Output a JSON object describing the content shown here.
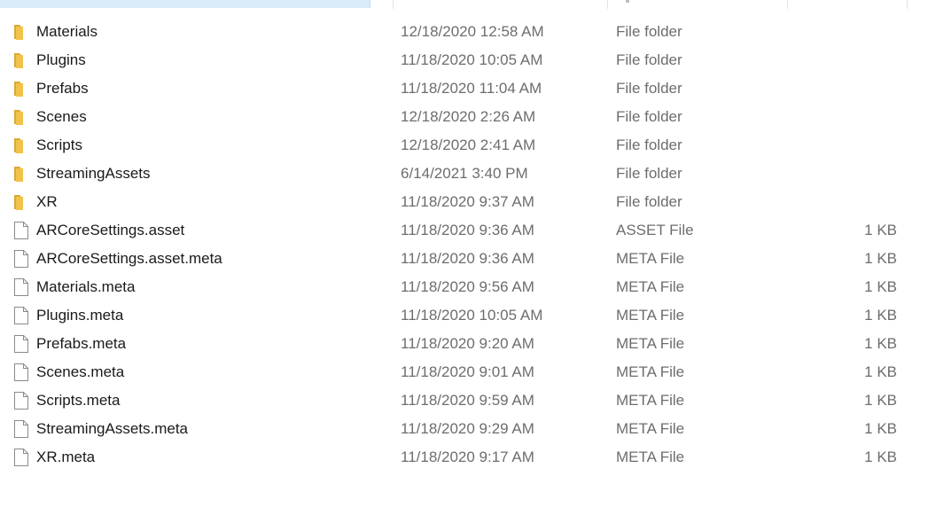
{
  "colors": {
    "folder": "#f2c34a",
    "folder_dark": "#dba933",
    "file_outline": "#8a8a8a",
    "header_selected": "#d9ebf9",
    "secondary_text": "#6d6d6d"
  },
  "files": [
    {
      "name": "Materials",
      "date": "12/18/2020 12:58 AM",
      "type": "File folder",
      "size": "",
      "icon": "folder-icon"
    },
    {
      "name": "Plugins",
      "date": "11/18/2020 10:05 AM",
      "type": "File folder",
      "size": "",
      "icon": "folder-icon"
    },
    {
      "name": "Prefabs",
      "date": "11/18/2020 11:04 AM",
      "type": "File folder",
      "size": "",
      "icon": "folder-icon"
    },
    {
      "name": "Scenes",
      "date": "12/18/2020 2:26 AM",
      "type": "File folder",
      "size": "",
      "icon": "folder-icon"
    },
    {
      "name": "Scripts",
      "date": "12/18/2020 2:41 AM",
      "type": "File folder",
      "size": "",
      "icon": "folder-icon"
    },
    {
      "name": "StreamingAssets",
      "date": "6/14/2021 3:40 PM",
      "type": "File folder",
      "size": "",
      "icon": "folder-icon"
    },
    {
      "name": "XR",
      "date": "11/18/2020 9:37 AM",
      "type": "File folder",
      "size": "",
      "icon": "folder-icon"
    },
    {
      "name": "ARCoreSettings.asset",
      "date": "11/18/2020 9:36 AM",
      "type": "ASSET File",
      "size": "1 KB",
      "icon": "file-icon"
    },
    {
      "name": "ARCoreSettings.asset.meta",
      "date": "11/18/2020 9:36 AM",
      "type": "META File",
      "size": "1 KB",
      "icon": "file-icon"
    },
    {
      "name": "Materials.meta",
      "date": "11/18/2020 9:56 AM",
      "type": "META File",
      "size": "1 KB",
      "icon": "file-icon"
    },
    {
      "name": "Plugins.meta",
      "date": "11/18/2020 10:05 AM",
      "type": "META File",
      "size": "1 KB",
      "icon": "file-icon"
    },
    {
      "name": "Prefabs.meta",
      "date": "11/18/2020 9:20 AM",
      "type": "META File",
      "size": "1 KB",
      "icon": "file-icon"
    },
    {
      "name": "Scenes.meta",
      "date": "11/18/2020 9:01 AM",
      "type": "META File",
      "size": "1 KB",
      "icon": "file-icon"
    },
    {
      "name": "Scripts.meta",
      "date": "11/18/2020 9:59 AM",
      "type": "META File",
      "size": "1 KB",
      "icon": "file-icon"
    },
    {
      "name": "StreamingAssets.meta",
      "date": "11/18/2020 9:29 AM",
      "type": "META File",
      "size": "1 KB",
      "icon": "file-icon"
    },
    {
      "name": "XR.meta",
      "date": "11/18/2020 9:17 AM",
      "type": "META File",
      "size": "1 KB",
      "icon": "file-icon"
    }
  ]
}
